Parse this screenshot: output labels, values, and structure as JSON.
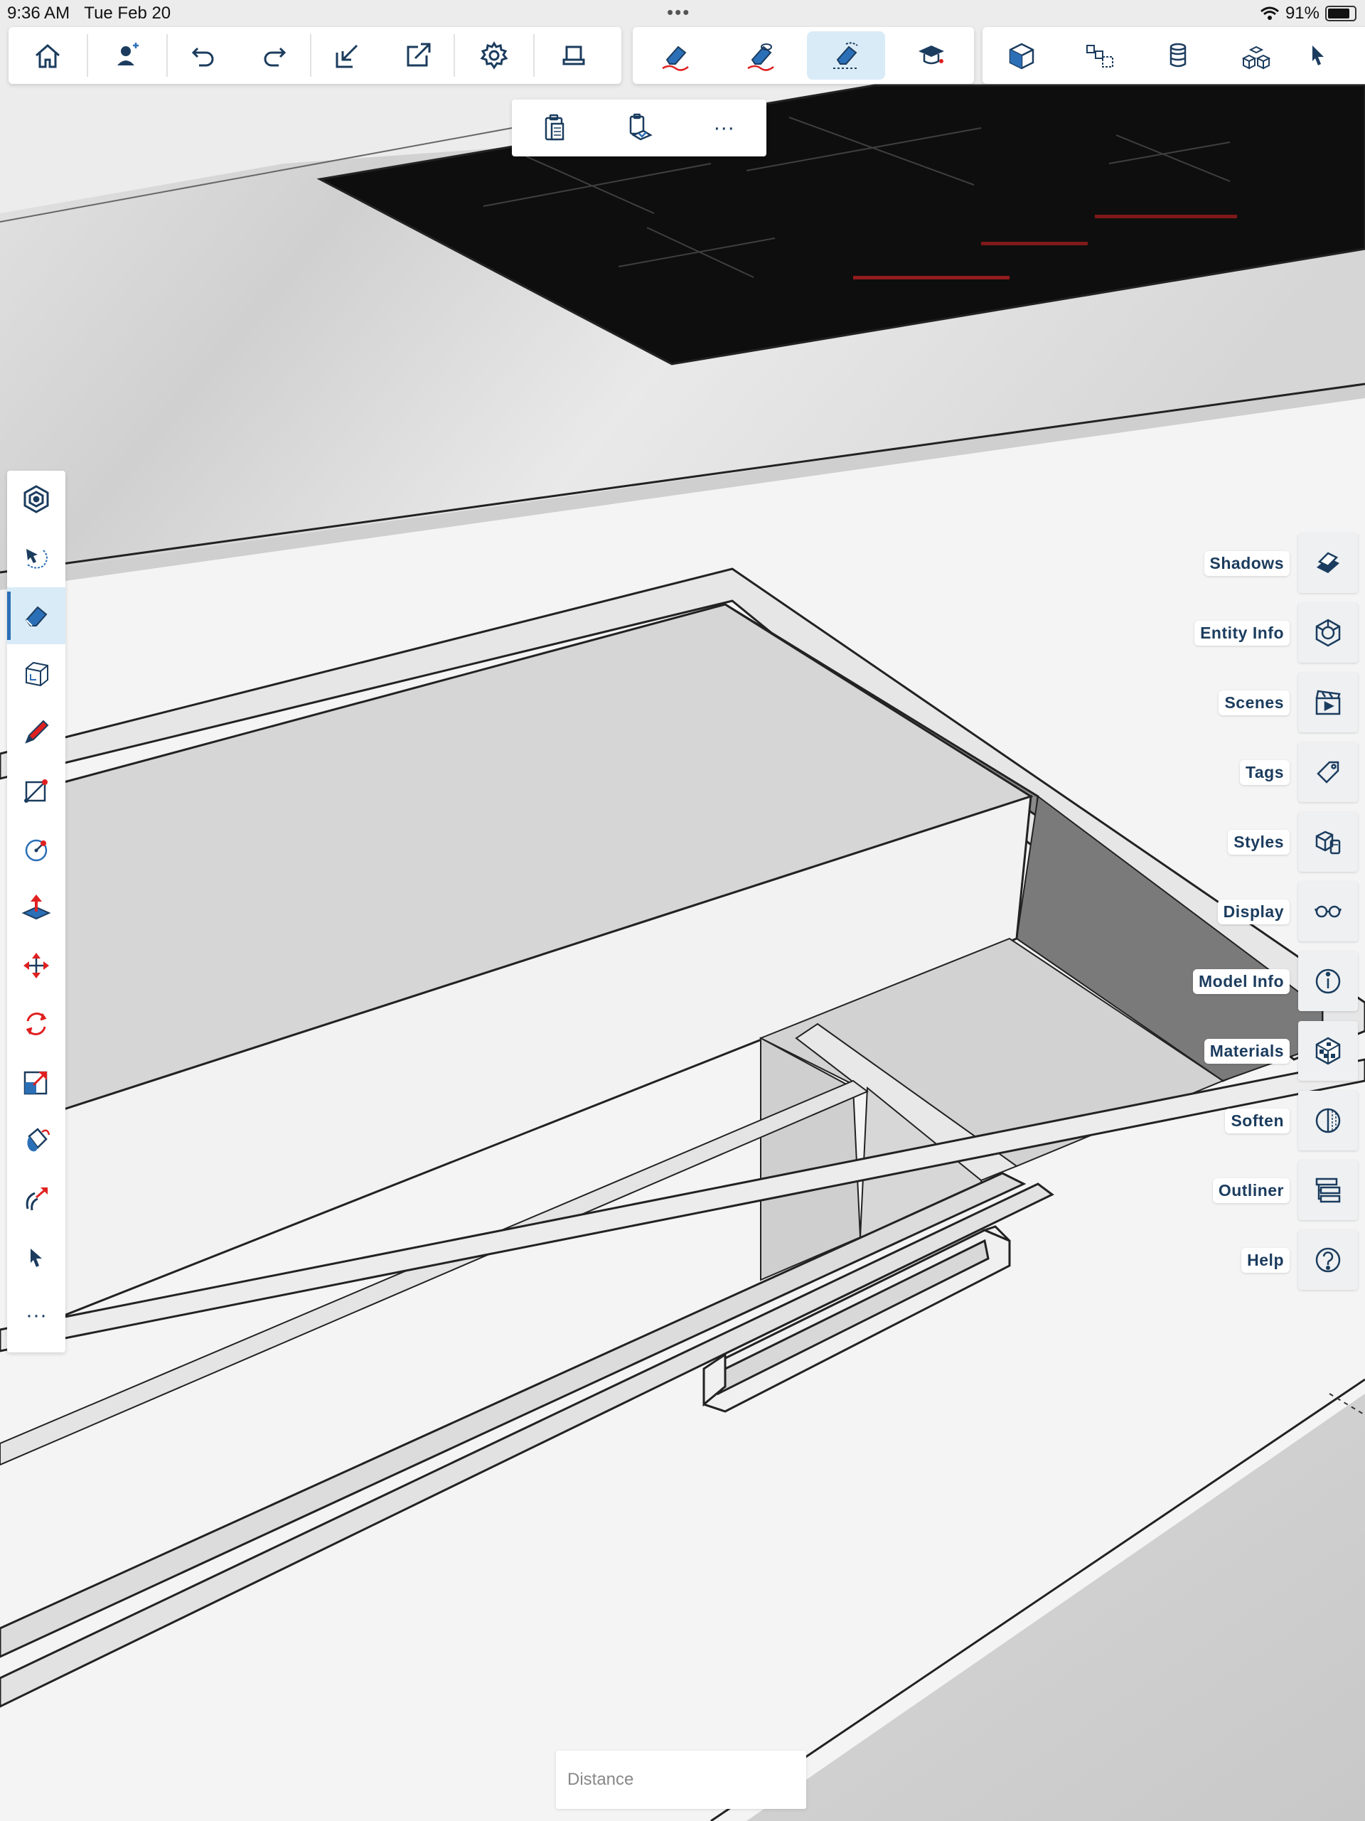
{
  "status_bar": {
    "time": "9:36 AM",
    "date": "Tue Feb 20",
    "dots": "•••",
    "battery": "91%"
  },
  "main_toolbar": {
    "icons": [
      "home-icon",
      "add-user-icon",
      "undo-icon",
      "redo-icon",
      "import-icon",
      "export-icon",
      "settings-icon",
      "tray-icon"
    ]
  },
  "eraser_toolbar": {
    "icons": [
      "erase-icon",
      "hide-icon",
      "soften-erase-icon",
      "learn-icon"
    ],
    "active_index": 2
  },
  "view_toolbar": {
    "icons": [
      "iso-view-icon",
      "components-icon",
      "cylinder-icon",
      "cubes-icon",
      "cursor-icon"
    ]
  },
  "subbar": {
    "icons": [
      "paste-icon",
      "paste-in-place-icon",
      "more-icon"
    ],
    "more_label": "···"
  },
  "left_palette": {
    "tools": [
      "sketchup-icon",
      "orbit-icon",
      "eraser-icon",
      "box-icon",
      "pencil-icon",
      "rectangle-icon",
      "circle-icon",
      "push-pull-icon",
      "move-icon",
      "rotate-icon",
      "scale-icon",
      "paint-icon",
      "follow-me-icon",
      "select-icon",
      "more-icon"
    ],
    "active_index": 2,
    "more_label": "···"
  },
  "right_panels": [
    {
      "label": "Shadows",
      "icon": "shadows-icon"
    },
    {
      "label": "Entity Info",
      "icon": "entity-info-icon"
    },
    {
      "label": "Scenes",
      "icon": "scenes-icon"
    },
    {
      "label": "Tags",
      "icon": "tags-icon"
    },
    {
      "label": "Styles",
      "icon": "styles-icon"
    },
    {
      "label": "Display",
      "icon": "display-icon"
    },
    {
      "label": "Model Info",
      "icon": "model-info-icon"
    },
    {
      "label": "Materials",
      "icon": "materials-icon"
    },
    {
      "label": "Soften",
      "icon": "soften-icon"
    },
    {
      "label": "Outliner",
      "icon": "outliner-icon"
    },
    {
      "label": "Help",
      "icon": "help-icon"
    }
  ],
  "measure_box": {
    "placeholder": "Distance"
  },
  "colors": {
    "accent": "#2b6fb7",
    "icon": "#1b3c5e",
    "red": "#e02020",
    "active_bg": "#d9ebf7"
  }
}
